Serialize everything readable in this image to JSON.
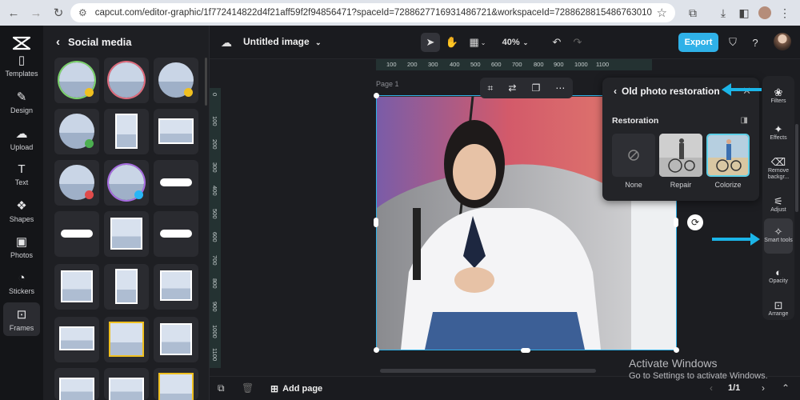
{
  "browser": {
    "url": "capcut.com/editor-graphic/1f772414822d4f21aff59f2f94856471?spaceId=7288627716931486721&workspaceId=7288628815486763010"
  },
  "rail": {
    "items": [
      {
        "label": "Templates",
        "icon": "templates-icon"
      },
      {
        "label": "Design",
        "icon": "design-icon"
      },
      {
        "label": "Upload",
        "icon": "upload-icon"
      },
      {
        "label": "Text",
        "icon": "text-icon"
      },
      {
        "label": "Shapes",
        "icon": "shapes-icon"
      },
      {
        "label": "Photos",
        "icon": "photos-icon"
      },
      {
        "label": "Stickers",
        "icon": "stickers-icon"
      },
      {
        "label": "Frames",
        "icon": "frames-icon"
      }
    ],
    "active": "Frames"
  },
  "panel": {
    "title": "Social media"
  },
  "topbar": {
    "doc_title": "Untitled image",
    "zoom": "40%",
    "export_label": "Export"
  },
  "ruler": {
    "top_ticks": [
      "100",
      "200",
      "300",
      "400",
      "500",
      "600",
      "700",
      "800",
      "900",
      "1000",
      "1100"
    ],
    "left_ticks": [
      "0",
      "100",
      "200",
      "300",
      "400",
      "500",
      "600",
      "700",
      "800",
      "900",
      "1000",
      "1100"
    ]
  },
  "canvas": {
    "page_label": "Page 1"
  },
  "restoration": {
    "title": "Old photo restoration",
    "section": "Restoration",
    "options": [
      {
        "label": "None"
      },
      {
        "label": "Repair"
      },
      {
        "label": "Colorize"
      }
    ],
    "selected": "Colorize"
  },
  "right_tools": {
    "items": [
      {
        "label": "Filters",
        "icon": "filters-icon"
      },
      {
        "label": "Effects",
        "icon": "effects-icon"
      },
      {
        "label": "Remove backgr...",
        "icon": "remove-background-icon"
      },
      {
        "label": "Adjust",
        "icon": "adjust-icon"
      },
      {
        "label": "Smart tools",
        "icon": "smart-tools-icon"
      },
      {
        "label": "Opacity",
        "icon": "opacity-icon"
      },
      {
        "label": "Arrange",
        "icon": "arrange-icon"
      }
    ],
    "active": "Smart tools"
  },
  "bottombar": {
    "add_page": "Add page",
    "pager": "1/1"
  },
  "watermark": {
    "line1": "Activate Windows",
    "line2": "Go to Settings to activate Windows."
  },
  "colors": {
    "accent": "#2fb1e8",
    "annotation_arrow": "#1bb5e8"
  }
}
